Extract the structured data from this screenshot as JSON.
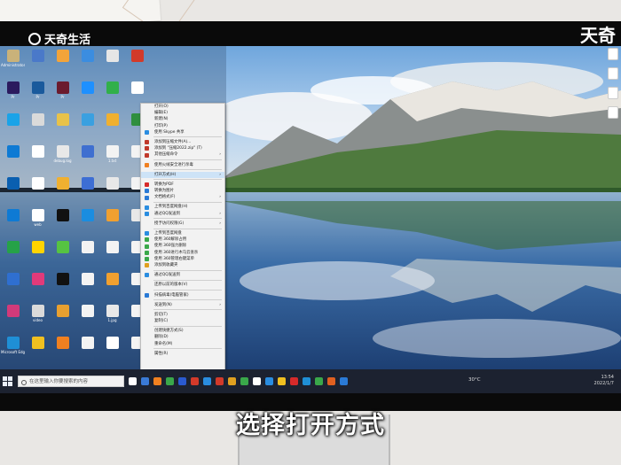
{
  "watermark": {
    "brand": "天奇生活",
    "corner_brand": "天奇"
  },
  "subtitle": "选择打开方式",
  "desktop_icons": [
    {
      "label": "Administrator",
      "color": "#c9b27a"
    },
    {
      "label": "",
      "color": "#4a79c9"
    },
    {
      "label": "",
      "color": "#f3a43a"
    },
    {
      "label": "",
      "color": "#3b8de0"
    },
    {
      "label": "",
      "color": "#e6e6e6"
    },
    {
      "label": "",
      "color": "#d23a2a"
    },
    {
      "label": "Pr",
      "color": "#2b1a5e"
    },
    {
      "label": "Pr",
      "color": "#1a5a9c"
    },
    {
      "label": "Pr",
      "color": "#6b1b2e"
    },
    {
      "label": "",
      "color": "#1e90ff"
    },
    {
      "label": "",
      "color": "#31b04a"
    },
    {
      "label": "",
      "color": "#ffffff"
    },
    {
      "label": "",
      "color": "#1aa3e8"
    },
    {
      "label": "",
      "color": "#dadada"
    },
    {
      "label": "",
      "color": "#e8c24a"
    },
    {
      "label": "",
      "color": "#3aa0e0"
    },
    {
      "label": "",
      "color": "#f0b030"
    },
    {
      "label": "",
      "color": "#2f8f3f"
    },
    {
      "label": "",
      "color": "#0e7ad4"
    },
    {
      "label": "",
      "color": "#ffffff"
    },
    {
      "label": "debug.log",
      "color": "#e8e8e8"
    },
    {
      "label": "",
      "color": "#3f6fd0"
    },
    {
      "label": "1.txt",
      "color": "#f3f3f3"
    },
    {
      "label": "",
      "color": "#f3f3f3"
    },
    {
      "label": "",
      "color": "#0a5fb0"
    },
    {
      "label": "",
      "color": "#ffffff"
    },
    {
      "label": "",
      "color": "#f0b030"
    },
    {
      "label": "",
      "color": "#3d6ed4"
    },
    {
      "label": "",
      "color": "#e8e8e8"
    },
    {
      "label": "",
      "color": "#f3f3f3"
    },
    {
      "label": "",
      "color": "#0e7ad4"
    },
    {
      "label": "web",
      "color": "#ffffff"
    },
    {
      "label": "",
      "color": "#111111"
    },
    {
      "label": "",
      "color": "#1a8de0"
    },
    {
      "label": "",
      "color": "#f0a030"
    },
    {
      "label": "",
      "color": "#e8e8e8"
    },
    {
      "label": "",
      "color": "#26a248"
    },
    {
      "label": "",
      "color": "#ffd400"
    },
    {
      "label": "",
      "color": "#56c342"
    },
    {
      "label": "",
      "color": "#f3f3f3"
    },
    {
      "label": "",
      "color": "#f3f3f3"
    },
    {
      "label": "",
      "color": "#f3f3f3"
    },
    {
      "label": "",
      "color": "#2f6fd0"
    },
    {
      "label": "",
      "color": "#e03a7a"
    },
    {
      "label": "",
      "color": "#111111"
    },
    {
      "label": "",
      "color": "#f3f3f3"
    },
    {
      "label": "",
      "color": "#f0a030"
    },
    {
      "label": "",
      "color": "#f3f3f3"
    },
    {
      "label": "",
      "color": "#d23a7a"
    },
    {
      "label": "video",
      "color": "#dadada"
    },
    {
      "label": "",
      "color": "#e8a030"
    },
    {
      "label": "",
      "color": "#f3f3f3"
    },
    {
      "label": "1.jpg",
      "color": "#e8e8e8"
    },
    {
      "label": "",
      "color": "#f3f3f3"
    },
    {
      "label": "Microsoft Edge",
      "color": "#1f8fd6"
    },
    {
      "label": "",
      "color": "#f0c020"
    },
    {
      "label": "",
      "color": "#f08020"
    },
    {
      "label": "",
      "color": "#f3f3f3"
    },
    {
      "label": "",
      "color": "#ffffff"
    },
    {
      "label": "",
      "color": "#f3f3f3"
    }
  ],
  "right_icons": [
    {
      "label": ""
    },
    {
      "label": ""
    },
    {
      "label": ""
    },
    {
      "label": ""
    }
  ],
  "context_menu": {
    "items": [
      {
        "label": "打开(O)",
        "color": "",
        "sub": false
      },
      {
        "label": "编辑(E)",
        "color": "",
        "sub": false
      },
      {
        "label": "新建(N)",
        "color": "",
        "sub": false
      },
      {
        "label": "打印(P)",
        "color": "",
        "sub": false
      },
      {
        "label": "使用 Skype 共享",
        "color": "#2a8de0",
        "sub": false
      },
      {
        "sep": true
      },
      {
        "label": "添加到压缩文件(A)...",
        "color": "#c0392b",
        "sub": false
      },
      {
        "label": "添加到 \"压缩2022.zip\" (T)",
        "color": "#c0392b",
        "sub": false
      },
      {
        "label": "其他压缩命令",
        "color": "#c0392b",
        "sub": true
      },
      {
        "sep": true
      },
      {
        "label": "使用火绒安全进行杀毒",
        "color": "#f08020",
        "sub": false
      },
      {
        "sep": true
      },
      {
        "label": "打开方式(H)",
        "color": "",
        "sub": true,
        "hl": true
      },
      {
        "sep": true
      },
      {
        "label": "转换为PDF",
        "color": "#d62a2a",
        "sub": false
      },
      {
        "label": "转换为图片",
        "color": "#2a7ad6",
        "sub": false
      },
      {
        "label": "文档格式(F)",
        "color": "#2a7ad6",
        "sub": true
      },
      {
        "sep": true
      },
      {
        "label": "上传到百度网盘(H)",
        "color": "#2a8de0",
        "sub": false
      },
      {
        "label": "通过QQ发送到",
        "color": "#2a8de0",
        "sub": true
      },
      {
        "sep": true
      },
      {
        "label": "授予访问权限(G)",
        "color": "",
        "sub": true
      },
      {
        "sep": true
      },
      {
        "label": "上传到百度网盘",
        "color": "#2a8de0",
        "sub": false
      },
      {
        "label": "使用 360解除占用",
        "color": "#3aa84a",
        "sub": false
      },
      {
        "label": "使用 360强力删除",
        "color": "#3aa84a",
        "sub": false
      },
      {
        "label": "使用 360进行木马云查杀",
        "color": "#3aa84a",
        "sub": false
      },
      {
        "label": "使用 360管理右键菜单",
        "color": "#3aa84a",
        "sub": false
      },
      {
        "label": "添加到收藏夹",
        "color": "#e0a020",
        "sub": false
      },
      {
        "sep": true
      },
      {
        "label": "通过QQ发送到",
        "color": "#2a8de0",
        "sub": false
      },
      {
        "sep": true
      },
      {
        "label": "还原以前的版本(V)",
        "color": "",
        "sub": false
      },
      {
        "sep": true
      },
      {
        "label": "扫描病毒(电脑管家)",
        "color": "#2a7ad6",
        "sub": false
      },
      {
        "sep": true
      },
      {
        "label": "发送到(N)",
        "color": "",
        "sub": true
      },
      {
        "sep": true
      },
      {
        "label": "剪切(T)",
        "color": "",
        "sub": false
      },
      {
        "label": "复制(C)",
        "color": "",
        "sub": false
      },
      {
        "sep": true
      },
      {
        "label": "创建快捷方式(S)",
        "color": "",
        "sub": false
      },
      {
        "label": "删除(D)",
        "color": "",
        "sub": false
      },
      {
        "label": "重命名(M)",
        "color": "",
        "sub": false
      },
      {
        "sep": true
      },
      {
        "label": "属性(R)",
        "color": "",
        "sub": false
      }
    ]
  },
  "taskbar": {
    "search_placeholder": "在这里输入你要搜索的内容",
    "weather": "30°C",
    "time": "13:54",
    "date": "2022/1/7",
    "apps": [
      "#ffffff",
      "#3a7ad6",
      "#f08020",
      "#3aa84a",
      "#2a5ad0",
      "#d23a2a",
      "#2a8de0",
      "#d23a2a",
      "#e0a020",
      "#3aa84a",
      "#ffffff",
      "#2a8de0",
      "#f0c020",
      "#d62a2a",
      "#1f8fd6",
      "#3aa84a",
      "#e06020",
      "#2a7ad6"
    ]
  },
  "colors": {
    "sky": "#9cc3e8",
    "lake": "#2a5d9e",
    "taskbar": "#1c2230"
  }
}
